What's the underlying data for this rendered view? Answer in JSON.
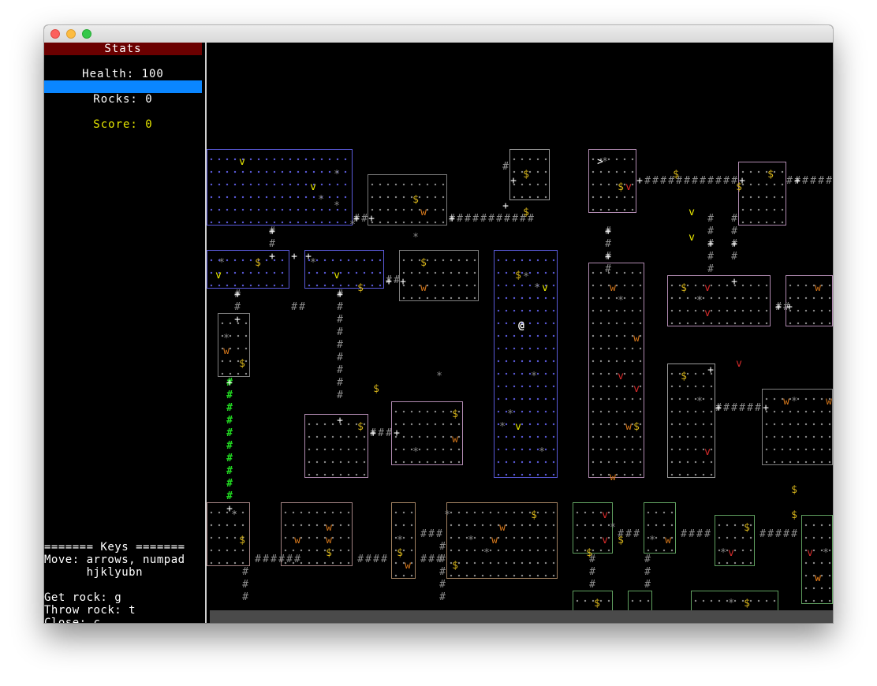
{
  "sidebar": {
    "header": "Stats",
    "health_label": "Health: 100",
    "health_fraction": 1.0,
    "rocks_label": "Rocks: 0",
    "score_label": "Score: 0",
    "keys_text": "======= Keys =======\nMove: arrows, numpad\n      hjklyubn\n\nGet rock: g\nThrow rock: t\nClose: c"
  },
  "colors": {
    "health_bar": "#0a86ff",
    "stats_header": "#6b0000",
    "score_text": "#e6e600",
    "player": "#ffffff",
    "gold": "#d4b21a",
    "wolf": "#d4761a",
    "vampire_red": "#d42a2a",
    "viper_yellow": "#e6e600",
    "rock": "#8a8a8a",
    "corridor": "#8c8c8c",
    "lit_corridor": "#22dd22"
  },
  "map": {
    "rooms": [
      {
        "id": "r1",
        "border": "#5a5ad8"
      },
      {
        "id": "r2",
        "border": "#7a7a7a"
      },
      {
        "id": "r3",
        "border": "#9a9a9a"
      },
      {
        "id": "r4",
        "border": "#b08ab0"
      },
      {
        "id": "r5",
        "border": "#b08ab0"
      },
      {
        "id": "r6",
        "border": "#5a5ad8"
      },
      {
        "id": "r7",
        "border": "#5a5ad8"
      },
      {
        "id": "r8",
        "border": "#808080"
      },
      {
        "id": "r9",
        "border": "#5a5ad8"
      },
      {
        "id": "r10",
        "border": "#b08ab0"
      },
      {
        "id": "r11",
        "border": "#b08ab0"
      },
      {
        "id": "r12",
        "border": "#b08ab0"
      },
      {
        "id": "r13",
        "border": "#9a9a9a"
      },
      {
        "id": "r14",
        "border": "#808080"
      },
      {
        "id": "r15",
        "border": "#808080"
      },
      {
        "id": "r16",
        "border": "#b08ab0"
      },
      {
        "id": "r17",
        "border": "#b08ab0"
      },
      {
        "id": "r18",
        "border": "#a08080"
      },
      {
        "id": "r19",
        "border": "#a08080"
      },
      {
        "id": "r20",
        "border": "#a08060"
      },
      {
        "id": "r21",
        "border": "#a08060"
      },
      {
        "id": "r22",
        "border": "#60a060"
      },
      {
        "id": "r23",
        "border": "#60a060"
      },
      {
        "id": "r24",
        "border": "#60a060"
      },
      {
        "id": "r25",
        "border": "#60a060"
      },
      {
        "id": "r26",
        "border": "#60a060"
      },
      {
        "id": "r27",
        "border": "#60a060"
      },
      {
        "id": "r28",
        "border": "#60a060"
      }
    ],
    "entities": [
      {
        "glyph": "@",
        "kind": "player",
        "color": "#ffffff"
      },
      {
        "glyph": "v",
        "kind": "viper",
        "color": "#e6e600"
      },
      {
        "glyph": "v",
        "kind": "viper",
        "color": "#e6e600"
      },
      {
        "glyph": "v",
        "kind": "viper",
        "color": "#e6e600"
      },
      {
        "glyph": "v",
        "kind": "viper",
        "color": "#e6e600"
      },
      {
        "glyph": "v",
        "kind": "viper",
        "color": "#e6e600"
      },
      {
        "glyph": "v",
        "kind": "viper",
        "color": "#e6e600"
      },
      {
        "glyph": "v",
        "kind": "viper",
        "color": "#e6e600"
      },
      {
        "glyph": "v",
        "kind": "viper",
        "color": "#e6e600"
      },
      {
        "glyph": "v",
        "kind": "vampire",
        "color": "#d42a2a"
      },
      {
        "glyph": "v",
        "kind": "vampire",
        "color": "#d42a2a"
      },
      {
        "glyph": "v",
        "kind": "vampire",
        "color": "#d42a2a"
      },
      {
        "glyph": "v",
        "kind": "vampire",
        "color": "#d42a2a"
      },
      {
        "glyph": "v",
        "kind": "vampire",
        "color": "#d42a2a"
      },
      {
        "glyph": "v",
        "kind": "vampire",
        "color": "#d42a2a"
      },
      {
        "glyph": "v",
        "kind": "vampire",
        "color": "#d42a2a"
      },
      {
        "glyph": "v",
        "kind": "vampire",
        "color": "#d42a2a"
      },
      {
        "glyph": "v",
        "kind": "vampire",
        "color": "#d42a2a"
      },
      {
        "glyph": "v",
        "kind": "vampire",
        "color": "#d42a2a"
      },
      {
        "glyph": "v",
        "kind": "vampire",
        "color": "#d42a2a"
      },
      {
        "glyph": "w",
        "kind": "wolf",
        "color": "#d4761a"
      },
      {
        "glyph": "w",
        "kind": "wolf",
        "color": "#d4761a"
      },
      {
        "glyph": "w",
        "kind": "wolf",
        "color": "#d4761a"
      },
      {
        "glyph": "w",
        "kind": "wolf",
        "color": "#d4761a"
      },
      {
        "glyph": "w",
        "kind": "wolf",
        "color": "#d4761a"
      },
      {
        "glyph": "w",
        "kind": "wolf",
        "color": "#d4761a"
      },
      {
        "glyph": "w",
        "kind": "wolf",
        "color": "#d4761a"
      },
      {
        "glyph": "w",
        "kind": "wolf",
        "color": "#d4761a"
      },
      {
        "glyph": "w",
        "kind": "wolf",
        "color": "#d4761a"
      },
      {
        "glyph": "w",
        "kind": "wolf",
        "color": "#d4761a"
      },
      {
        "glyph": "w",
        "kind": "wolf",
        "color": "#d4761a"
      },
      {
        "glyph": "w",
        "kind": "wolf",
        "color": "#d4761a"
      },
      {
        "glyph": "w",
        "kind": "wolf",
        "color": "#d4761a"
      },
      {
        "glyph": "w",
        "kind": "wolf",
        "color": "#d4761a"
      },
      {
        "glyph": "w",
        "kind": "wolf",
        "color": "#d4761a"
      },
      {
        "glyph": "w",
        "kind": "wolf",
        "color": "#d4761a"
      },
      {
        "glyph": "w",
        "kind": "wolf",
        "color": "#d4761a"
      },
      {
        "glyph": "w",
        "kind": "wolf",
        "color": "#d4761a"
      },
      {
        "glyph": "w",
        "kind": "wolf",
        "color": "#d4761a"
      },
      {
        "glyph": "w",
        "kind": "wolf",
        "color": "#d4761a"
      },
      {
        "glyph": "$",
        "kind": "gold",
        "color": "#d4b21a"
      },
      {
        "glyph": "$",
        "kind": "gold",
        "color": "#d4b21a"
      },
      {
        "glyph": "$",
        "kind": "gold",
        "color": "#d4b21a"
      },
      {
        "glyph": "$",
        "kind": "gold",
        "color": "#d4b21a"
      },
      {
        "glyph": "$",
        "kind": "gold",
        "color": "#d4b21a"
      },
      {
        "glyph": "$",
        "kind": "gold",
        "color": "#d4b21a"
      },
      {
        "glyph": "$",
        "kind": "gold",
        "color": "#d4b21a"
      },
      {
        "glyph": "$",
        "kind": "gold",
        "color": "#d4b21a"
      },
      {
        "glyph": "$",
        "kind": "gold",
        "color": "#d4b21a"
      },
      {
        "glyph": "$",
        "kind": "gold",
        "color": "#d4b21a"
      },
      {
        "glyph": "$",
        "kind": "gold",
        "color": "#d4b21a"
      },
      {
        "glyph": "$",
        "kind": "gold",
        "color": "#d4b21a"
      },
      {
        "glyph": "$",
        "kind": "gold",
        "color": "#d4b21a"
      },
      {
        "glyph": "$",
        "kind": "gold",
        "color": "#d4b21a"
      },
      {
        "glyph": "$",
        "kind": "gold",
        "color": "#d4b21a"
      },
      {
        "glyph": "$",
        "kind": "gold",
        "color": "#d4b21a"
      },
      {
        "glyph": "$",
        "kind": "gold",
        "color": "#d4b21a"
      },
      {
        "glyph": "$",
        "kind": "gold",
        "color": "#d4b21a"
      },
      {
        "glyph": "$",
        "kind": "gold",
        "color": "#d4b21a"
      },
      {
        "glyph": "$",
        "kind": "gold",
        "color": "#d4b21a"
      },
      {
        "glyph": "$",
        "kind": "gold",
        "color": "#d4b21a"
      },
      {
        "glyph": "$",
        "kind": "gold",
        "color": "#d4b21a"
      },
      {
        "glyph": "$",
        "kind": "gold",
        "color": "#d4b21a"
      },
      {
        "glyph": "$",
        "kind": "gold",
        "color": "#d4b21a"
      },
      {
        "glyph": "$",
        "kind": "gold",
        "color": "#d4b21a"
      },
      {
        "glyph": "$",
        "kind": "gold",
        "color": "#d4b21a"
      },
      {
        "glyph": "$",
        "kind": "gold",
        "color": "#d4b21a"
      },
      {
        "glyph": "$",
        "kind": "gold",
        "color": "#d4b21a"
      },
      {
        "glyph": "$",
        "kind": "gold",
        "color": "#d4b21a"
      },
      {
        "glyph": "$",
        "kind": "gold",
        "color": "#d4b21a"
      },
      {
        "glyph": "*",
        "kind": "rock",
        "color": "#8a8a8a"
      },
      {
        "glyph": "*",
        "kind": "rock",
        "color": "#8a8a8a"
      },
      {
        "glyph": "*",
        "kind": "rock",
        "color": "#8a8a8a"
      },
      {
        "glyph": "*",
        "kind": "rock",
        "color": "#8a8a8a"
      },
      {
        "glyph": "*",
        "kind": "rock",
        "color": "#8a8a8a"
      },
      {
        "glyph": "*",
        "kind": "rock",
        "color": "#8a8a8a"
      },
      {
        "glyph": "*",
        "kind": "rock",
        "color": "#8a8a8a"
      },
      {
        "glyph": "*",
        "kind": "rock",
        "color": "#8a8a8a"
      },
      {
        "glyph": "*",
        "kind": "rock",
        "color": "#8a8a8a"
      },
      {
        "glyph": "*",
        "kind": "rock",
        "color": "#8a8a8a"
      },
      {
        "glyph": "*",
        "kind": "rock",
        "color": "#8a8a8a"
      },
      {
        "glyph": "*",
        "kind": "rock",
        "color": "#8a8a8a"
      },
      {
        "glyph": "*",
        "kind": "rock",
        "color": "#8a8a8a"
      },
      {
        "glyph": "*",
        "kind": "rock",
        "color": "#8a8a8a"
      },
      {
        "glyph": "*",
        "kind": "rock",
        "color": "#8a8a8a"
      },
      {
        "glyph": "*",
        "kind": "rock",
        "color": "#8a8a8a"
      },
      {
        "glyph": "*",
        "kind": "rock",
        "color": "#8a8a8a"
      },
      {
        "glyph": "*",
        "kind": "rock",
        "color": "#8a8a8a"
      },
      {
        "glyph": "*",
        "kind": "rock",
        "color": "#8a8a8a"
      },
      {
        "glyph": "*",
        "kind": "rock",
        "color": "#8a8a8a"
      },
      {
        "glyph": "*",
        "kind": "rock",
        "color": "#8a8a8a"
      },
      {
        "glyph": "*",
        "kind": "rock",
        "color": "#8a8a8a"
      },
      {
        "glyph": "*",
        "kind": "rock",
        "color": "#8a8a8a"
      },
      {
        "glyph": "*",
        "kind": "rock",
        "color": "#8a8a8a"
      },
      {
        "glyph": "*",
        "kind": "rock",
        "color": "#8a8a8a"
      },
      {
        "glyph": "*",
        "kind": "rock",
        "color": "#8a8a8a"
      },
      {
        "glyph": "*",
        "kind": "rock",
        "color": "#8a8a8a"
      },
      {
        "glyph": "*",
        "kind": "rock",
        "color": "#8a8a8a"
      },
      {
        "glyph": "*",
        "kind": "rock",
        "color": "#8a8a8a"
      },
      {
        "glyph": "*",
        "kind": "rock",
        "color": "#8a8a8a"
      },
      {
        "glyph": "*",
        "kind": "rock",
        "color": "#8a8a8a"
      },
      {
        "glyph": "*",
        "kind": "rock",
        "color": "#8a8a8a"
      },
      {
        "glyph": ">",
        "kind": "stairs",
        "color": "#ffffff"
      }
    ]
  }
}
